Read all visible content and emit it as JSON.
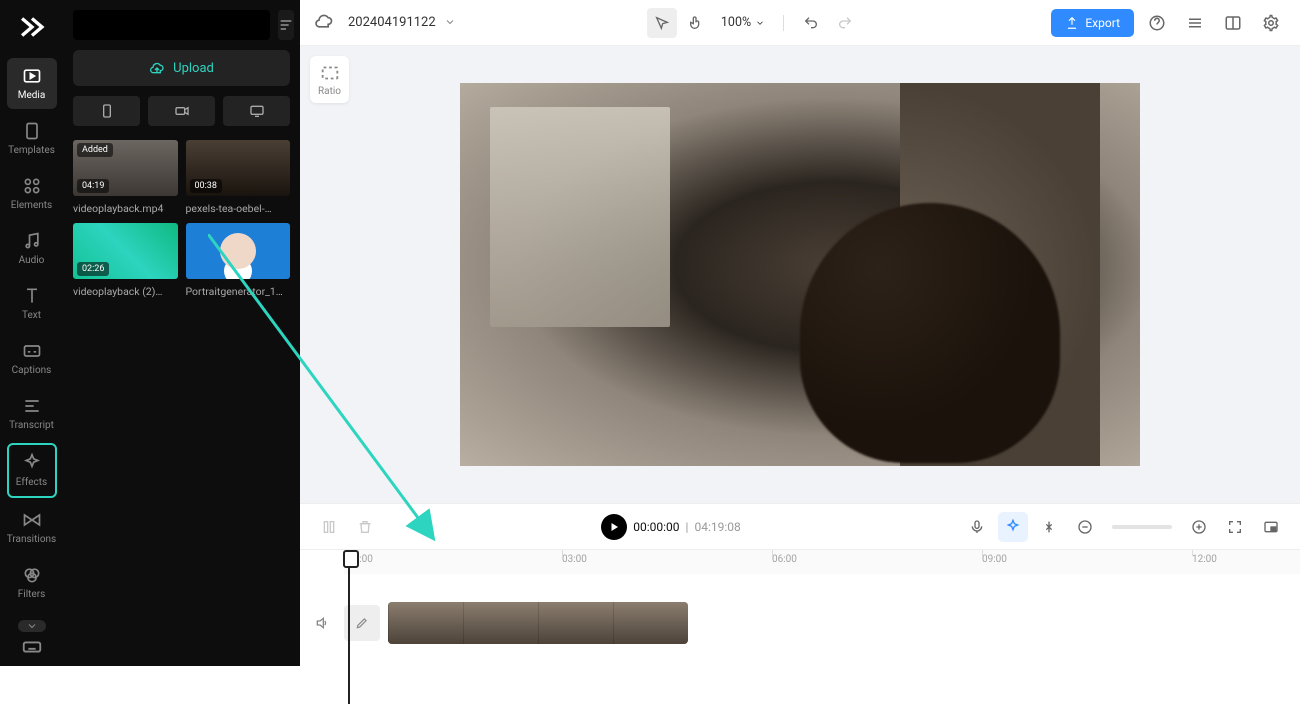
{
  "rail": {
    "media": "Media",
    "templates": "Templates",
    "elements": "Elements",
    "audio": "Audio",
    "text": "Text",
    "captions": "Captions",
    "transcript": "Transcript",
    "effects": "Effects",
    "transitions": "Transitions",
    "filters": "Filters"
  },
  "panel": {
    "upload": "Upload",
    "items": [
      {
        "name": "videoplayback.mp4",
        "duration": "04:19",
        "added": "Added"
      },
      {
        "name": "pexels-tea-oebel-…",
        "duration": "00:38"
      },
      {
        "name": "videoplayback (2)…",
        "duration": "02:26"
      },
      {
        "name": "Portraitgenerator_1…"
      }
    ]
  },
  "topbar": {
    "project": "202404191122",
    "zoom": "100%",
    "export": "Export"
  },
  "ratio": {
    "label": "Ratio"
  },
  "transport": {
    "current": "00:00:00",
    "sep": "|",
    "total": "04:19:08"
  },
  "ruler": {
    "t0": "00:00",
    "t1": "03:00",
    "t2": "06:00",
    "t3": "09:00",
    "t4": "12:00"
  }
}
